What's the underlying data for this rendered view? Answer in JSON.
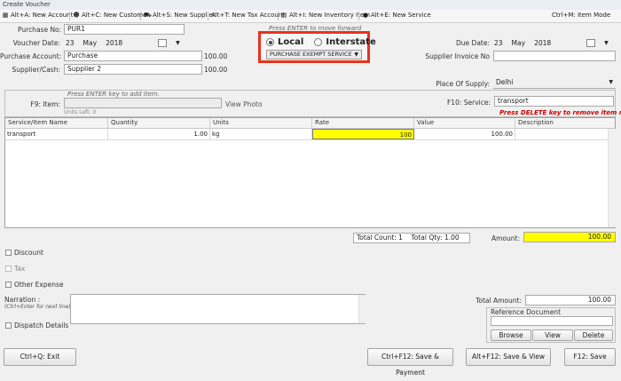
{
  "window": {
    "title": "Create Voucher"
  },
  "toolbar": {
    "new_account": "Alt+A: New Account",
    "new_customer": "Alt+C: New Customer",
    "new_supplier": "Alt+S: New Supplier",
    "new_tax_account": "Alt+T: New Tax Account",
    "new_inventory_item": "Alt+I: New Inventory Item",
    "new_service": "Alt+E: New Service",
    "item_mode": "Ctrl+M: Item Mode"
  },
  "form": {
    "purchase_no_label": "Purchase No:",
    "purchase_no": "PUR1",
    "voucher_date_label": "Voucher Date:",
    "voucher_date": {
      "day": "23",
      "month": "May",
      "year": "2018"
    },
    "purchase_account_label": "Purchase Account:",
    "purchase_account": "Purchase",
    "purchase_account_amount": "100.00",
    "supplier_label": "Supplier/Cash:",
    "supplier": "Supplier 2",
    "supplier_amount": "100.00",
    "due_date_label": "Due Date:",
    "due_date": {
      "day": "23",
      "month": "May",
      "year": "2018"
    },
    "supplier_invoice_label": "Supplier Invoice No",
    "supplier_invoice": "",
    "place_of_supply_label": "Place Of Supply:",
    "place_of_supply": "Delhi"
  },
  "tax_mode": {
    "hint": "Press ENTER to move forward",
    "local": "Local",
    "interstate": "Interstate",
    "selected": "Local",
    "purchase_type": "PURCHASE EXEMPT SERVICE"
  },
  "item_entry": {
    "hint": "Press ENTER key to add item.",
    "item_label": "F9: Item:",
    "item_value": "",
    "view_photo": "View Photo",
    "units_left": "Units Left: 0",
    "service_label": "F10: Service:",
    "service_value": "transport",
    "delete_hint": "Press DELETE key to remove item row."
  },
  "grid": {
    "columns": [
      "Service/Item Name",
      "Quantity",
      "Units",
      "Rate",
      "Value",
      "Description"
    ],
    "rows": [
      {
        "name": "transport",
        "quantity": "1.00",
        "units": "kg",
        "rate": "100",
        "value": "100.00",
        "description": ""
      }
    ]
  },
  "totals": {
    "count_label": "Total Count:",
    "count": "1",
    "qty_label": "Total Qty:",
    "qty": "1.00",
    "amount_label": "Amount:",
    "amount": "100.00",
    "total_amount_label": "Total Amount:",
    "total_amount": "100.00"
  },
  "options": {
    "discount": "Discount",
    "tax": "Tax",
    "other_expense": "Other Expense",
    "narration_label": "Narration :",
    "narration_hint": "(Ctrl+Enter for next line)",
    "narration": "",
    "dispatch_details": "Dispatch Details",
    "reference_document_label": "Reference Document",
    "browse": "Browse",
    "view": "View",
    "delete": "Delete"
  },
  "footer": {
    "exit": "Ctrl+Q: Exit",
    "save_payment": "Ctrl+F12: Save & Payment",
    "save_view": "Alt+F12: Save & View",
    "save": "F12: Save"
  },
  "colors": {
    "highlight_yellow": "#ffff00",
    "highlight_border": "#e8321e",
    "hint_red": "#cc0000"
  }
}
